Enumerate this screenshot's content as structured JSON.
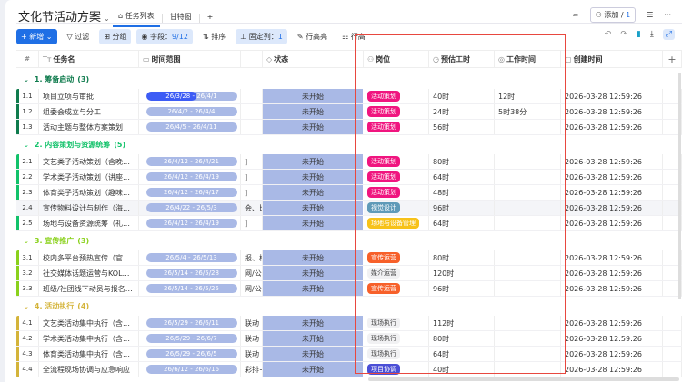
{
  "header": {
    "title": "文化节活动方案",
    "tabs": [
      {
        "label": "任务列表",
        "active": true
      },
      {
        "label": "甘特图",
        "active": false
      }
    ],
    "add_tab": "+",
    "add_member": "添加 / ",
    "member_count": "1",
    "more": "···"
  },
  "toolbar": {
    "new": "+ 新增",
    "filter": "过滤",
    "group": "分组",
    "fields_label": "字段：",
    "fields_value": "9/12",
    "sort": "排序",
    "pin_label": "固定列：",
    "pin_value": "1",
    "row_height": "行高亮",
    "row_more": "行高"
  },
  "columns": {
    "num": "#",
    "task": "任务名",
    "range": "时间范围",
    "status": "状态",
    "position": "岗位",
    "estimate": "预估工时",
    "worktime": "工作时间",
    "created": "创建时间",
    "add": "+"
  },
  "colors": {
    "accent": "#1f6fe5",
    "highlight_box": "#e8483f"
  },
  "groups": [
    {
      "title": "1. 筹备启动",
      "count": "(3)",
      "color": "#0f7b4d",
      "rows": [
        {
          "num": "1.1",
          "task": "项目立项与审批",
          "range": "26/3/28 - 26/4/1",
          "progress": 0.55,
          "extra": "",
          "status": "未开始",
          "position": "活动策划",
          "pos_color": "#f0157f",
          "estimate": "40时",
          "worktime": "12时",
          "created": "2026-03-28 12:59:26"
        },
        {
          "num": "1.2",
          "task": "组委会成立与分工",
          "range": "26/4/2 - 26/4/4",
          "extra": "",
          "status": "未开始",
          "position": "活动策划",
          "pos_color": "#f0157f",
          "estimate": "24时",
          "worktime": "5时38分",
          "created": "2026-03-28 12:59:26"
        },
        {
          "num": "1.3",
          "task": "活动主题与整体方案策划",
          "range": "26/4/5 - 26/4/11",
          "extra": "",
          "status": "未开始",
          "position": "活动策划",
          "pos_color": "#f0157f",
          "estimate": "56时",
          "worktime": "",
          "created": "2026-03-28 12:59:26"
        }
      ]
    },
    {
      "title": "2. 内容策划与资源统筹",
      "count": "(5)",
      "color": "#12c26a",
      "rows": [
        {
          "num": "2.1",
          "task": "文艺类子活动策划（含晚…",
          "range": "26/4/12 - 26/4/21",
          "extra": "]",
          "status": "未开始",
          "position": "活动策划",
          "pos_color": "#f0157f",
          "estimate": "80时",
          "worktime": "",
          "created": "2026-03-28 12:59:26"
        },
        {
          "num": "2.2",
          "task": "学术类子活动策划（讲座…",
          "range": "26/4/12 - 26/4/19",
          "extra": "]",
          "status": "未开始",
          "position": "活动策划",
          "pos_color": "#f0157f",
          "estimate": "64时",
          "worktime": "",
          "created": "2026-03-28 12:59:26"
        },
        {
          "num": "2.3",
          "task": "体育类子活动策划（趣味…",
          "range": "26/4/12 - 26/4/17",
          "extra": "]",
          "status": "未开始",
          "position": "活动策划",
          "pos_color": "#f0157f",
          "estimate": "48时",
          "worktime": "",
          "created": "2026-03-28 12:59:26"
        },
        {
          "num": "2.4",
          "task": "宣传物料设计与制作（海…",
          "range": "26/4/22 - 26/5/3",
          "extra": "会、比",
          "status": "未开始",
          "position": "视觉设计",
          "pos_color": "#5f9ab8",
          "estimate": "96时",
          "worktime": "",
          "created": "2026-03-28 12:59:26",
          "hl": true
        },
        {
          "num": "2.5",
          "task": "场地与设备资源统筹（礼…",
          "range": "26/4/12 - 26/4/19",
          "extra": "]",
          "status": "未开始",
          "position": "场地与设备管理",
          "pos_color": "#f7c21a",
          "estimate": "64时",
          "worktime": "",
          "created": "2026-03-28 12:59:26"
        }
      ]
    },
    {
      "title": "3. 宣传推广",
      "count": "(3)",
      "color": "#8ad11c",
      "rows": [
        {
          "num": "3.1",
          "task": "校内多平台预热宣传（官…",
          "range": "26/5/4 - 26/5/13",
          "extra": "报、校",
          "status": "未开始",
          "position": "宣传运营",
          "pos_color": "#f7602a",
          "estimate": "80时",
          "worktime": "",
          "created": "2026-03-28 12:59:26"
        },
        {
          "num": "3.2",
          "task": "社交媒体话题运营与KOL…",
          "range": "26/5/14 - 26/5/28",
          "extra": "网/公众",
          "status": "未开始",
          "position": "媒介运营",
          "pos_color": "",
          "estimate": "120时",
          "worktime": "",
          "created": "2026-03-28 12:59:26"
        },
        {
          "num": "3.3",
          "task": "班级/社团线下动员与报名…",
          "range": "26/5/14 - 26/5/25",
          "extra": "网/公众",
          "status": "未开始",
          "position": "宣传运营",
          "pos_color": "#f7602a",
          "estimate": "96时",
          "worktime": "",
          "created": "2026-03-28 12:59:26"
        }
      ]
    },
    {
      "title": "4. 活动执行",
      "count": "(4)",
      "color": "#d4b43a",
      "rows": [
        {
          "num": "4.1",
          "task": "文艺类活动集中执行（含…",
          "range": "26/5/29 - 26/6/11",
          "extra": "联动",
          "status": "未开始",
          "position": "现场执行",
          "pos_color": "",
          "estimate": "112时",
          "worktime": "",
          "created": "2026-03-28 12:59:26"
        },
        {
          "num": "4.2",
          "task": "学术类活动集中执行（含…",
          "range": "26/5/29 - 26/6/7",
          "extra": "联动",
          "status": "未开始",
          "position": "现场执行",
          "pos_color": "",
          "estimate": "80时",
          "worktime": "",
          "created": "2026-03-28 12:59:26"
        },
        {
          "num": "4.3",
          "task": "体育类活动集中执行（含…",
          "range": "26/5/29 - 26/6/5",
          "extra": "联动",
          "status": "未开始",
          "position": "现场执行",
          "pos_color": "",
          "estimate": "64时",
          "worktime": "",
          "created": "2026-03-28 12:59:26"
        },
        {
          "num": "4.4",
          "task": "全流程现场协调与应急响应",
          "range": "26/6/12 - 26/6/16",
          "extra": "彩排+",
          "status": "未开始",
          "position": "项目协调",
          "pos_color": "#4b4fd6",
          "estimate": "40时",
          "worktime": "",
          "created": "2026-03-28 12:59:26"
        }
      ]
    }
  ]
}
